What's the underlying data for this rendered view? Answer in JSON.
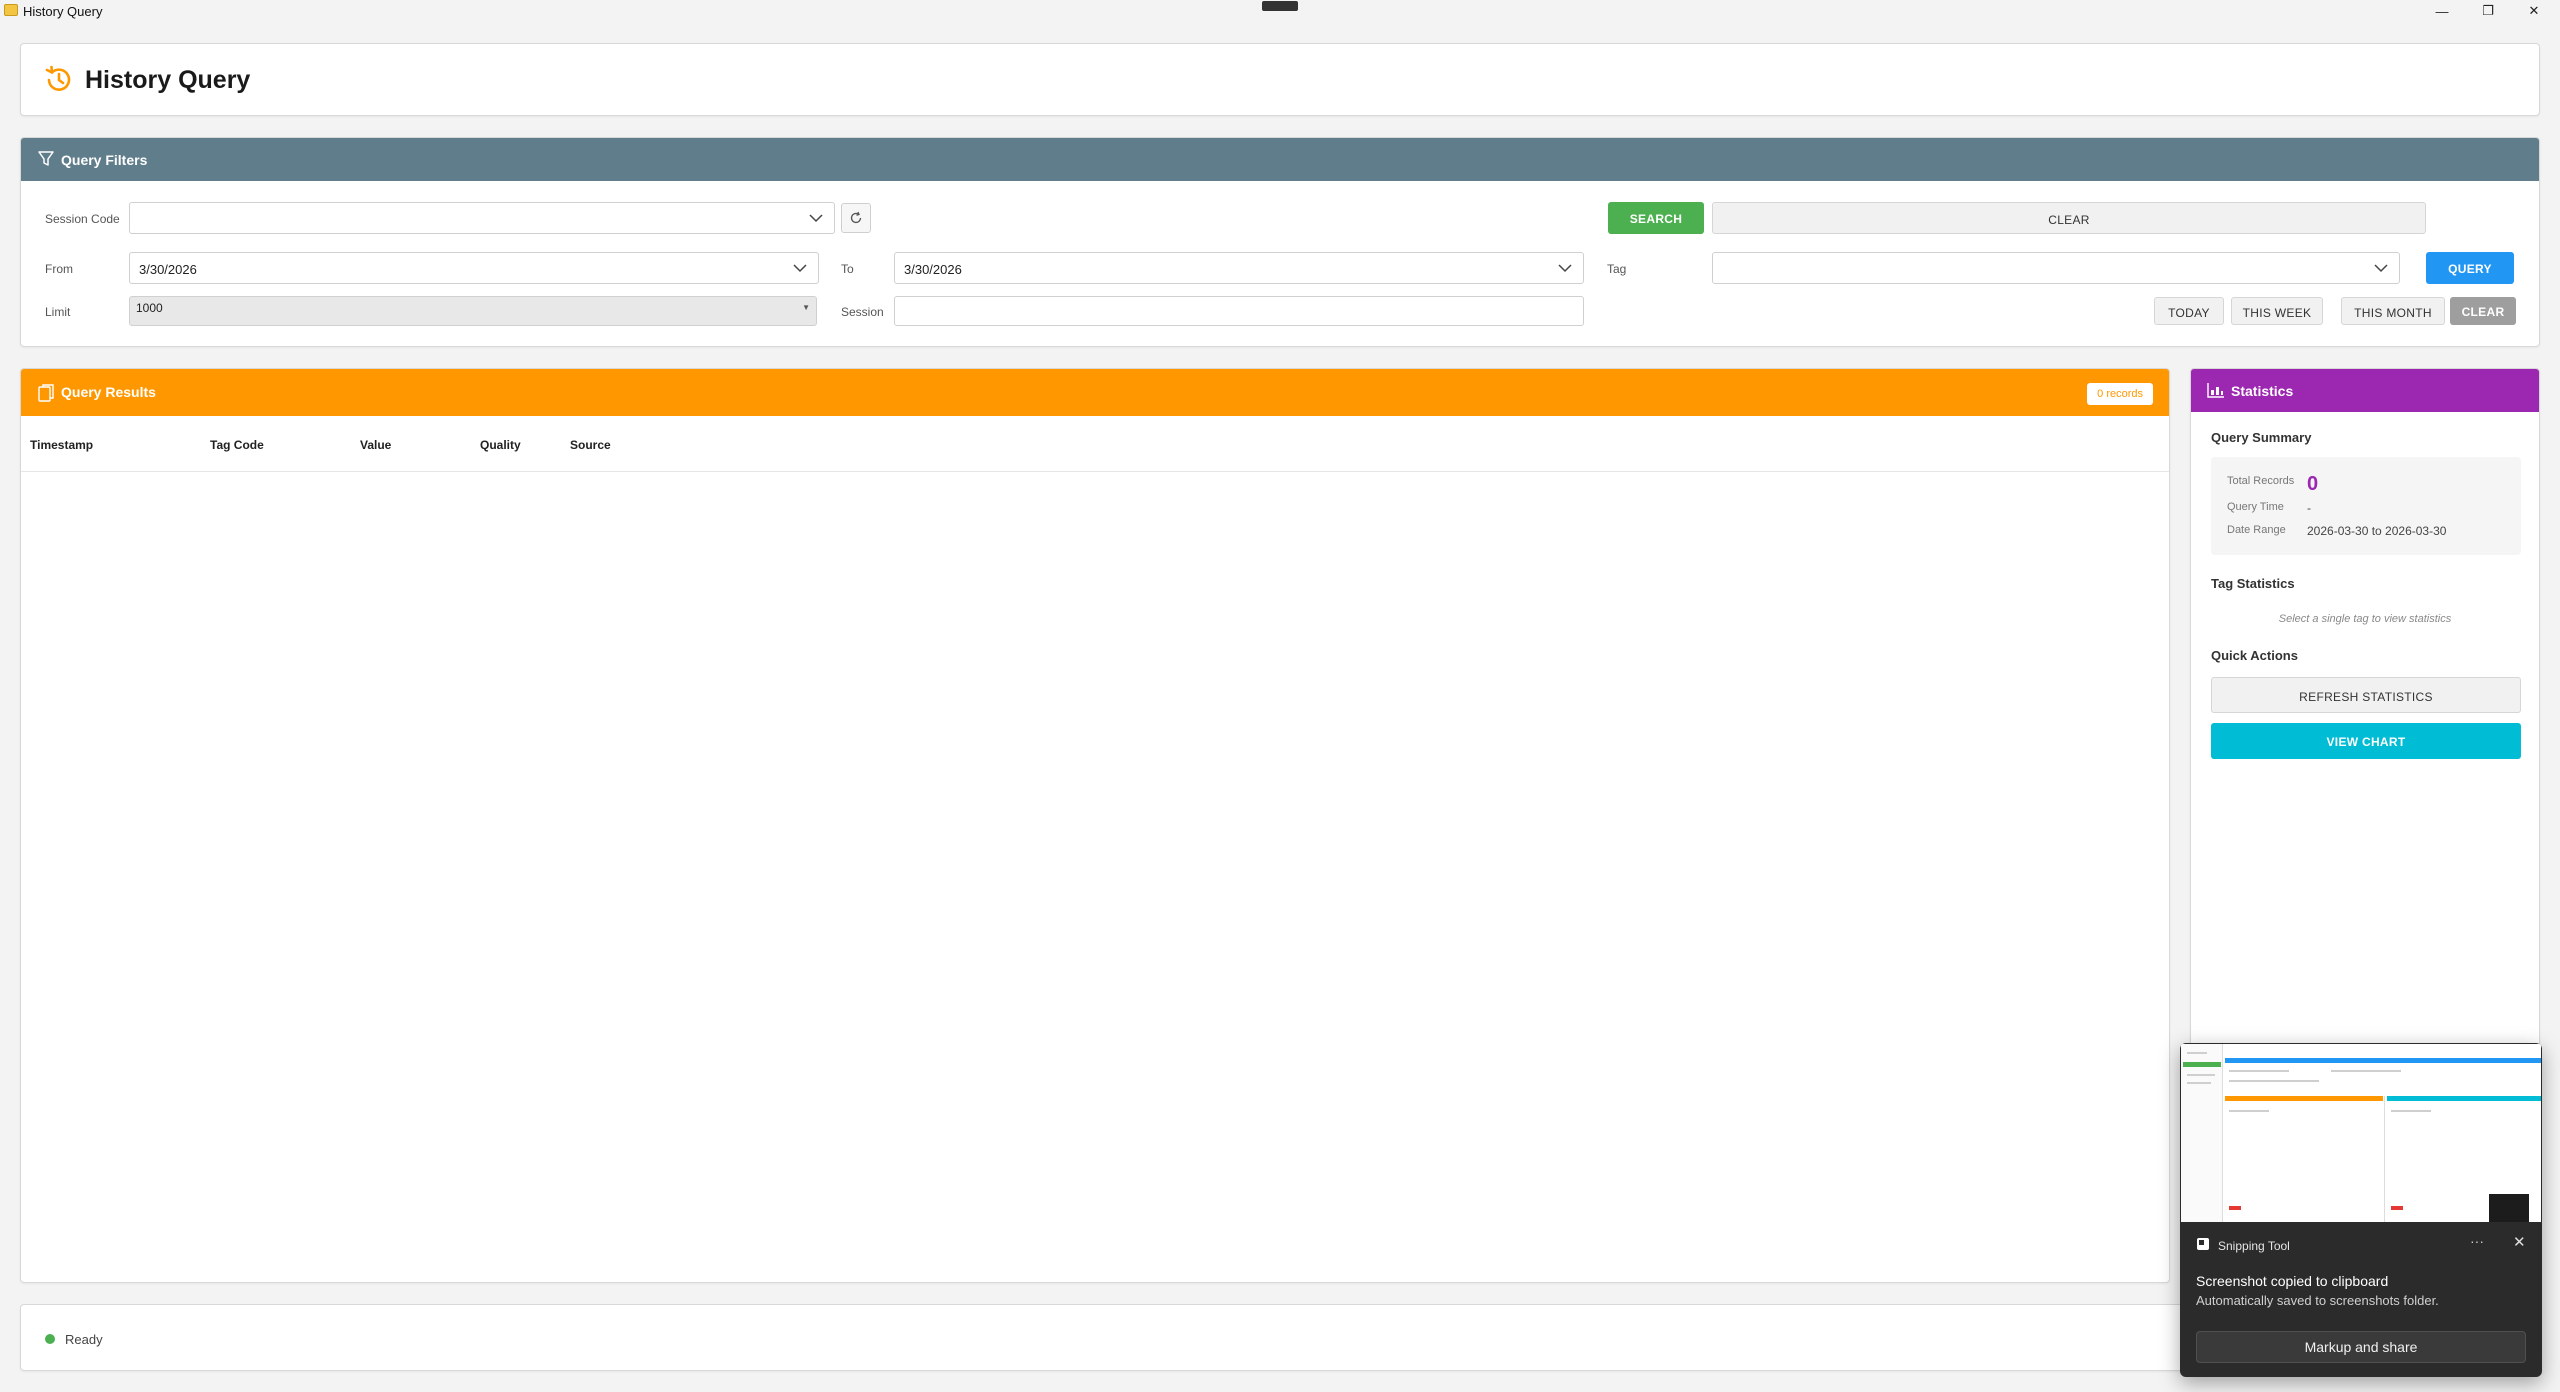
{
  "window": {
    "title": "History Query",
    "minimize": "—",
    "maximize": "❐",
    "close": "✕"
  },
  "header": {
    "title": "History Query",
    "icon": "history-icon",
    "accent": "#ff9800"
  },
  "filters": {
    "title": "Query Filters",
    "icon": "filter-icon",
    "bar_color": "#607d8b",
    "session_code_label": "Session Code",
    "session_code_value": "",
    "search_label": "SEARCH",
    "clear_top_label": "CLEAR",
    "from_label": "From",
    "from_value": "3/30/2026",
    "to_label": "To",
    "to_value": "3/30/2026",
    "tag_label": "Tag",
    "tag_value": "",
    "query_label": "QUERY",
    "limit_label": "Limit",
    "limit_value": "1000",
    "session_label": "Session",
    "session_value": "",
    "today_label": "TODAY",
    "this_week_label": "THIS WEEK",
    "this_month_label": "THIS MONTH",
    "clear_bottom_label": "CLEAR"
  },
  "results": {
    "title": "Query Results",
    "icon": "copy-icon",
    "bar_color": "#ff9800",
    "badge": "0 records",
    "columns": [
      "Timestamp",
      "Tag Code",
      "Value",
      "Quality",
      "Source"
    ],
    "rows": []
  },
  "stats": {
    "title": "Statistics",
    "icon": "chart-icon",
    "bar_color": "#9c27b0",
    "summary_heading": "Query Summary",
    "total_records_label": "Total Records",
    "total_records_value": "0",
    "query_time_label": "Query Time",
    "query_time_value": "-",
    "date_range_label": "Date Range",
    "date_range_value": "2026-03-30 to 2026-03-30",
    "tag_stats_heading": "Tag Statistics",
    "tag_stats_hint": "Select a single tag to view statistics",
    "quick_actions_heading": "Quick Actions",
    "refresh_label": "REFRESH STATISTICS",
    "view_chart_label": "VIEW CHART"
  },
  "status": {
    "text": "Ready",
    "color": "#4caf50"
  },
  "toast": {
    "app": "Snipping Tool",
    "more": "···",
    "close": "✕",
    "message": "Screenshot copied to clipboard",
    "sub": "Automatically saved to screenshots folder.",
    "action": "Markup and share"
  }
}
